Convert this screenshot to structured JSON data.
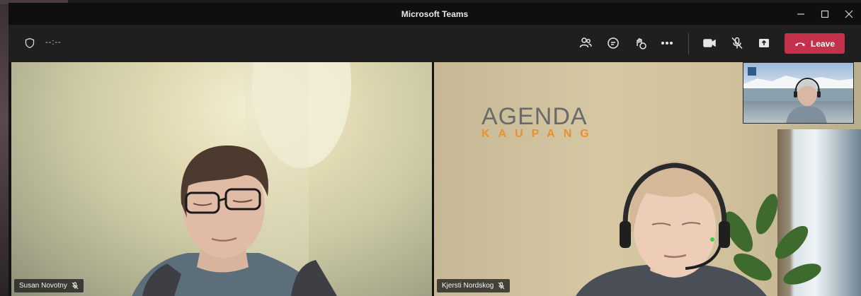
{
  "window": {
    "title": "Microsoft Teams"
  },
  "toolbar": {
    "timer": "--:--",
    "icons": [
      "people-icon",
      "chat-icon",
      "reactions-icon",
      "more-icon",
      "camera-icon",
      "mic-off-icon",
      "share-icon"
    ],
    "leave_label": "Leave"
  },
  "participants": [
    {
      "name": "Susan Novotny",
      "muted": true
    },
    {
      "name": "Kjersti Nordskog",
      "muted": true
    }
  ],
  "background_logo": {
    "line1": "AGENDA",
    "line2": "KAUPANG"
  },
  "colors": {
    "leave_button": "#c4314b",
    "titlebar": "#0f0f0f",
    "toolbar": "#1f1f1f",
    "logo_orange": "#e8902f"
  }
}
